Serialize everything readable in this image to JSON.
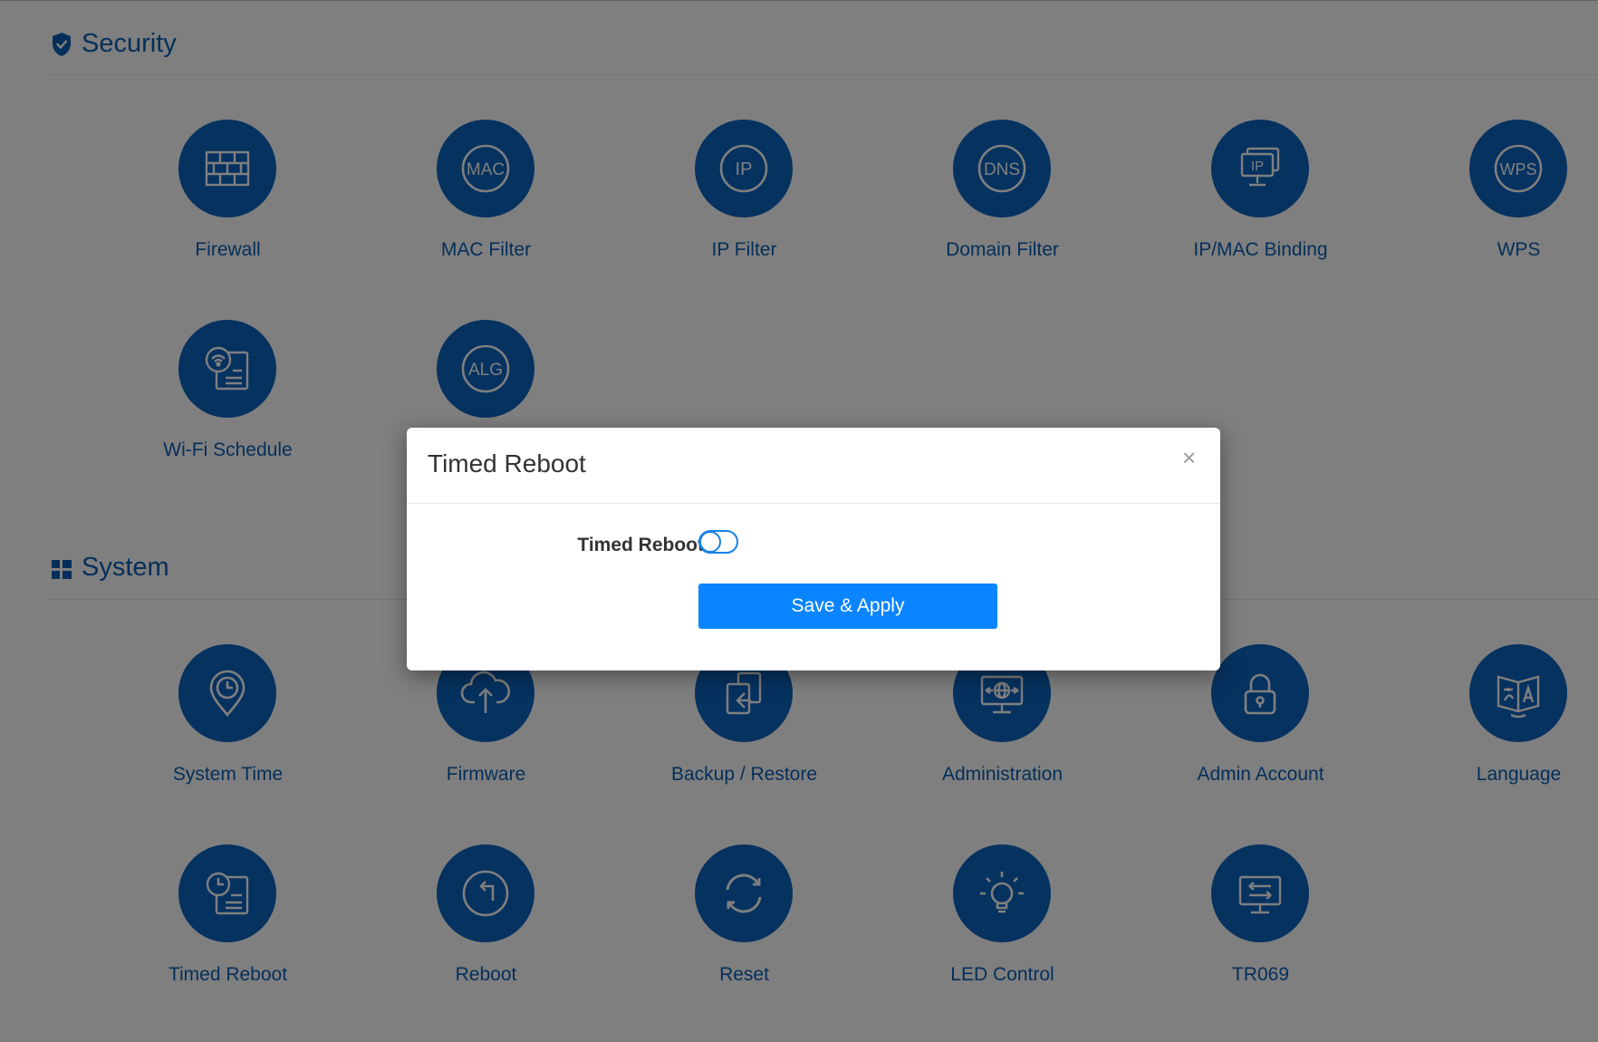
{
  "colors": {
    "accent": "#0c64c0",
    "label": "#0a5fb4",
    "button": "#0a85ff"
  },
  "security": {
    "title": "Security",
    "icon": "shield-icon",
    "tiles": [
      {
        "label": "Firewall",
        "icon": "firewall-icon"
      },
      {
        "label": "MAC Filter",
        "icon": "mac-icon",
        "badge": "MAC"
      },
      {
        "label": "IP Filter",
        "icon": "ip-icon",
        "badge": "IP"
      },
      {
        "label": "Domain Filter",
        "icon": "dns-icon",
        "badge": "DNS"
      },
      {
        "label": "IP/MAC Binding",
        "icon": "ip-mac-binding-icon",
        "badge": "IP"
      },
      {
        "label": "WPS",
        "icon": "wps-icon",
        "badge": "WPS"
      },
      {
        "label": "Wi-Fi Schedule",
        "icon": "wifi-schedule-icon"
      },
      {
        "label": "",
        "icon": "alg-icon",
        "badge": "ALG"
      }
    ]
  },
  "system": {
    "title": "System",
    "icon": "grid-icon",
    "tiles": [
      {
        "label": "System Time",
        "icon": "location-clock-icon"
      },
      {
        "label": "Firmware",
        "icon": "cloud-upload-icon"
      },
      {
        "label": "Backup / Restore",
        "icon": "backup-restore-icon"
      },
      {
        "label": "Administration",
        "icon": "globe-monitor-icon"
      },
      {
        "label": "Admin Account",
        "icon": "lock-icon"
      },
      {
        "label": "Language",
        "icon": "language-icon"
      },
      {
        "label": "Timed Reboot",
        "icon": "timed-reboot-icon"
      },
      {
        "label": "Reboot",
        "icon": "reboot-icon"
      },
      {
        "label": "Reset",
        "icon": "reset-icon"
      },
      {
        "label": "LED Control",
        "icon": "bulb-icon"
      },
      {
        "label": "TR069",
        "icon": "tr069-icon"
      }
    ]
  },
  "modal": {
    "title": "Timed Reboot",
    "close_label": "×",
    "field_label": "Timed Reboot",
    "toggle_enabled": false,
    "save_label": "Save & Apply"
  }
}
